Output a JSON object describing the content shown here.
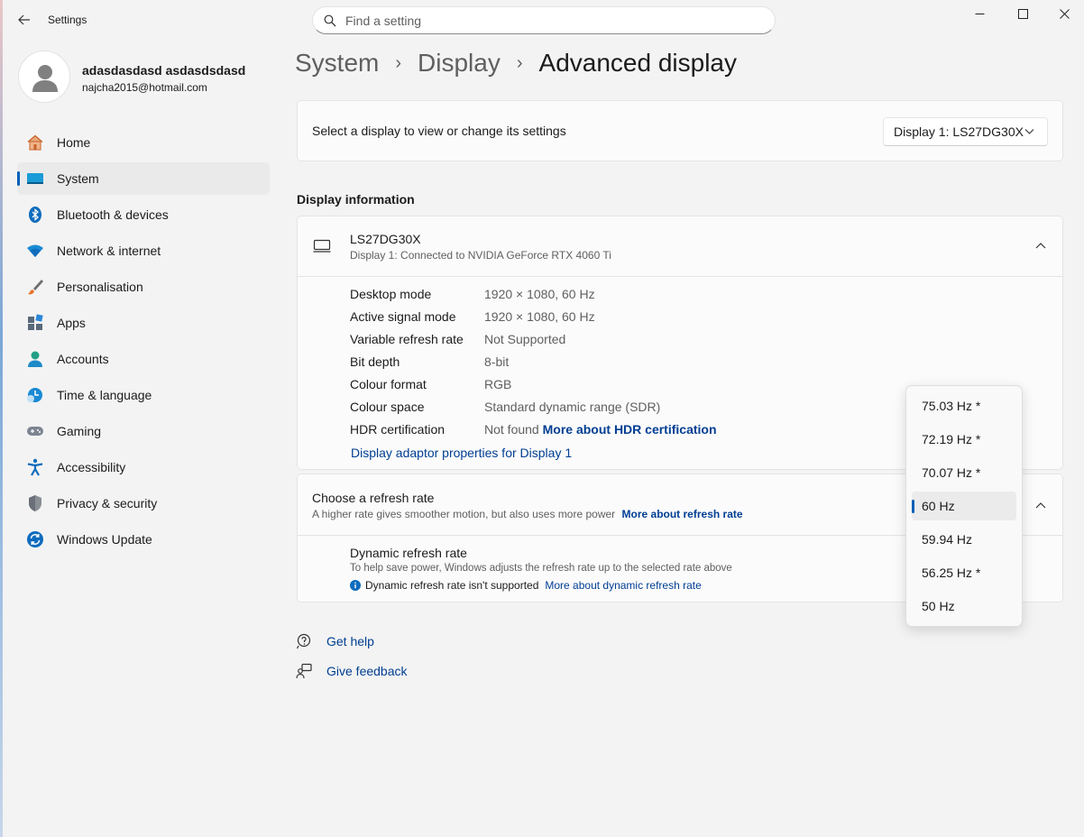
{
  "window": {
    "title": "Settings",
    "controls": {
      "minimize": "minimize-icon",
      "maximize": "maximize-icon",
      "close": "close-icon"
    }
  },
  "search": {
    "placeholder": "Find a setting"
  },
  "user": {
    "name": "adasdasdasd asdasdsdasd",
    "email": "najcha2015@hotmail.com"
  },
  "sidebar": {
    "items": [
      {
        "label": "Home",
        "icon": "home-icon"
      },
      {
        "label": "System",
        "icon": "system-icon",
        "active": true
      },
      {
        "label": "Bluetooth & devices",
        "icon": "bluetooth-icon"
      },
      {
        "label": "Network & internet",
        "icon": "wifi-icon"
      },
      {
        "label": "Personalisation",
        "icon": "brush-icon"
      },
      {
        "label": "Apps",
        "icon": "apps-icon"
      },
      {
        "label": "Accounts",
        "icon": "accounts-icon"
      },
      {
        "label": "Time & language",
        "icon": "time-language-icon"
      },
      {
        "label": "Gaming",
        "icon": "gamepad-icon"
      },
      {
        "label": "Accessibility",
        "icon": "accessibility-icon"
      },
      {
        "label": "Privacy & security",
        "icon": "shield-icon"
      },
      {
        "label": "Windows Update",
        "icon": "update-icon"
      }
    ]
  },
  "breadcrumb": {
    "items": [
      "System",
      "Display",
      "Advanced display"
    ]
  },
  "display_select": {
    "label": "Select a display to view or change its settings",
    "selected": "Display 1: LS27DG30X"
  },
  "display_info": {
    "heading": "Display information",
    "monitor_name": "LS27DG30X",
    "monitor_sub": "Display 1: Connected to NVIDIA GeForce RTX 4060 Ti",
    "rows": [
      {
        "key": "Desktop mode",
        "value": "1920 × 1080, 60 Hz"
      },
      {
        "key": "Active signal mode",
        "value": "1920 × 1080, 60 Hz"
      },
      {
        "key": "Variable refresh rate",
        "value": "Not Supported"
      },
      {
        "key": "Bit depth",
        "value": "8-bit"
      },
      {
        "key": "Colour format",
        "value": "RGB"
      },
      {
        "key": "Colour space",
        "value": "Standard dynamic range (SDR)"
      },
      {
        "key": "HDR certification",
        "value": "Not found",
        "link": "More about HDR certification"
      }
    ],
    "adapter_link": "Display adaptor properties for Display 1"
  },
  "refresh_rate": {
    "title": "Choose a refresh rate",
    "desc": "A higher rate gives smoother motion, but also uses more power",
    "desc_link": "More about refresh rate",
    "dynamic_title": "Dynamic refresh rate",
    "dynamic_desc": "To help save power, Windows adjusts the refresh rate up to the selected rate above",
    "dynamic_note": "Dynamic refresh rate isn't supported",
    "dynamic_link": "More about dynamic refresh rate",
    "options": [
      "75.03 Hz *",
      "72.19 Hz *",
      "70.07 Hz *",
      "60 Hz",
      "59.94 Hz",
      "56.25 Hz *",
      "50 Hz"
    ],
    "selected": "60 Hz"
  },
  "help": {
    "get_help": "Get help",
    "feedback": "Give feedback"
  }
}
